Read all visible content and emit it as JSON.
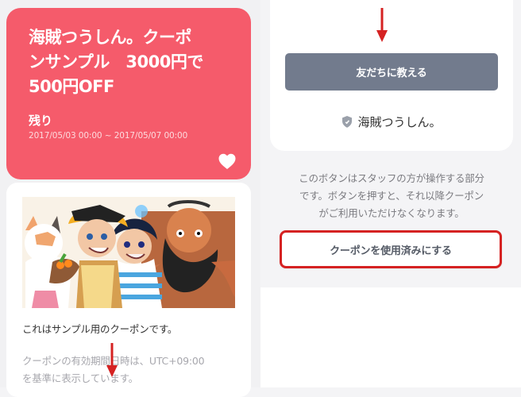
{
  "coupon": {
    "title": "海賊つうしん。クーポンサンプル　3000円で500円OFF",
    "title_display": "海賊つうしん。クーポ\nンサンプル　3000円で\n500円OFF",
    "remaining_label": "残り",
    "period": "2017/05/03 00:00 ~ 2017/05/07 00:00",
    "heart_icon": "heart-icon"
  },
  "detail": {
    "description": "これはサンプル用のクーポンです。",
    "timezone_note": "クーポンの有効期間日時は、UTC+09:00\nを基準に表示しています。"
  },
  "share_panel": {
    "share_button_label": "友だちに教える",
    "brand_name": "海賊つうしん。",
    "brand_icon": "shield-icon"
  },
  "staff_section": {
    "note": "このボタンはスタッフの方が操作する部分\nです。ボタンを押すと、それ以降クーポン\nがご利用いただけなくなります。",
    "use_button_label": "クーポンを使用済みにする"
  },
  "colors": {
    "coupon_bg": "#f55b6b",
    "share_button_bg": "#727b8d",
    "highlight_red": "#d52222"
  }
}
